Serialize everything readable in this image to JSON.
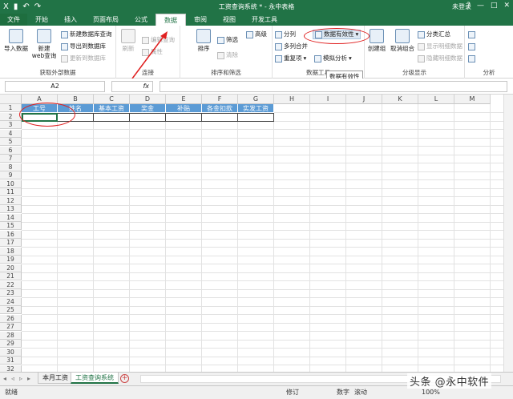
{
  "window": {
    "title": "工资查询系统 * - 永中表格",
    "user": "未登录",
    "quick_access": [
      "X",
      "▮",
      "↶",
      "↷"
    ],
    "controls": [
      "?",
      "—",
      "□",
      "✕"
    ]
  },
  "tabs": [
    {
      "label": "文件",
      "active": false
    },
    {
      "label": "开始",
      "active": false
    },
    {
      "label": "插入",
      "active": false
    },
    {
      "label": "页面布局",
      "active": false
    },
    {
      "label": "公式",
      "active": false
    },
    {
      "label": "数据",
      "active": true
    },
    {
      "label": "审阅",
      "active": false
    },
    {
      "label": "视图",
      "active": false
    },
    {
      "label": "开发工具",
      "active": false
    }
  ],
  "ribbon": {
    "get_external": {
      "label": "获取外部数据",
      "import": "导入数据",
      "new_web_query": [
        "新建",
        "web查询"
      ],
      "new_db_query": "新建数据库查询",
      "export_db": "导出到数据库",
      "update_db": "更新到数据库"
    },
    "connections": {
      "label": "连接",
      "refresh": "刷新",
      "edit_query": "编辑查询",
      "properties": "属性"
    },
    "sort_filter": {
      "label": "排序和筛选",
      "sort": "排序",
      "filter": "筛选",
      "clear": "清除",
      "advanced": "高级"
    },
    "data_tools": {
      "label": "数据工具",
      "split": "分列",
      "merge_cols": "多列合并",
      "duplicates": "重复项",
      "validation": "数据有效性",
      "validation_tooltip": "数据有效性",
      "whatif": "模拟分析"
    },
    "outline": {
      "label": "分级显示",
      "group": "创建组",
      "ungroup": "取消组合",
      "subtotal": "分类汇总",
      "show_detail": "显示明细数据",
      "hide_detail": "隐藏明细数据"
    },
    "analysis": {
      "label": "分析"
    }
  },
  "formula_bar": {
    "name_box": "A2",
    "fx": "fx",
    "content": ""
  },
  "sheet": {
    "columns": [
      "A",
      "B",
      "C",
      "D",
      "E",
      "F",
      "G",
      "H",
      "I",
      "J",
      "K",
      "L",
      "M"
    ],
    "rows": [
      "1",
      "2",
      "3",
      "4",
      "5",
      "6",
      "7",
      "8",
      "9",
      "10",
      "11",
      "12",
      "13",
      "14",
      "15",
      "16",
      "17",
      "18",
      "19",
      "20",
      "21",
      "22",
      "23",
      "24",
      "25",
      "26",
      "27",
      "28",
      "29",
      "30",
      "31",
      "32"
    ],
    "header_row": [
      "工号",
      "姓名",
      "基本工资",
      "奖金",
      "补贴",
      "各金扣款",
      "实发工资"
    ],
    "header_color": "#5b9bd5"
  },
  "sheet_tabs": [
    {
      "label": "本月工资",
      "active": false
    },
    {
      "label": "工资查询系统",
      "active": true
    }
  ],
  "status": {
    "ready": "就绪",
    "revise": "修订",
    "numeric": "数字",
    "scroll": "滚动",
    "zoom": "100%"
  },
  "watermark": "头条 @永中软件",
  "colors": {
    "accent": "#217346",
    "annotation": "#e02020"
  }
}
